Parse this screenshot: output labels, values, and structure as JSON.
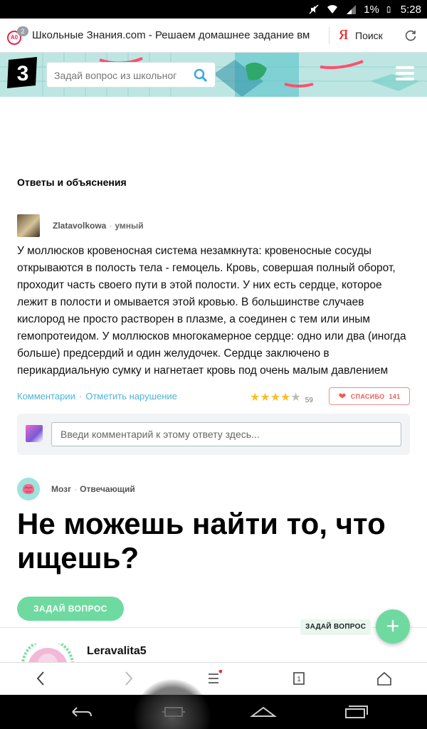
{
  "status_bar": {
    "battery": "1%",
    "time": "5:28"
  },
  "browser": {
    "tabs_badge_text": "A0",
    "tabs_count": "2",
    "url_title": "Школьные Знания.com - Решаем домашнее задание вм",
    "search_engine_logo": "Я",
    "search_label": "Поиск"
  },
  "site_header": {
    "logo_text": "3",
    "search_placeholder": "Задай вопрос из школьног"
  },
  "section_title": "Ответы и объяснения",
  "answer": {
    "author": "Zlatavolkowa",
    "rank": "умный",
    "text": "У моллюсков кровеносная система незамкнута: кровеносные сосуды открываются в полость тела - гемоцель. Кровь, совершая полный оборот, проходит часть своего пути в этой полости. У них есть сердце, которое лежит в полости и омывается этой кровью. В большинстве случаев кислород не просто растворен в плазме, а соединен с тем или иным гемопротеидом. У моллюсков многокамерное сердце: одно или два (иногда больше) предсердий и один желудочек. Сердце заключено в перикардиальную сумку и нагнетает кровь под очень малым давлением",
    "comments_link": "Комментарии",
    "report_link": "Отметить нарушение",
    "rating": 4,
    "rating_count": "59",
    "thanks_label": "СПАСИБО",
    "thanks_count": "141"
  },
  "comment": {
    "placeholder": "Введи комментарий к этому ответу здесь..."
  },
  "bot": {
    "name": "Мозг",
    "role": "Отвечающий"
  },
  "cta": {
    "heading": "Не можешь найти то, что ищешь?",
    "ask_button": "ЗАДАЙ ВОПРОС"
  },
  "fab": {
    "label": "ЗАДАЙ ВОПРОС",
    "icon": "+"
  },
  "next_user": {
    "name": "Leravalita5"
  },
  "browser_bottom": {
    "tabs_number": "1"
  },
  "colors": {
    "accent_green": "#6fdaa0",
    "link_blue": "#4fb3d9",
    "thanks_red": "#ef5a5a",
    "header_teal": "#bde6e3"
  }
}
